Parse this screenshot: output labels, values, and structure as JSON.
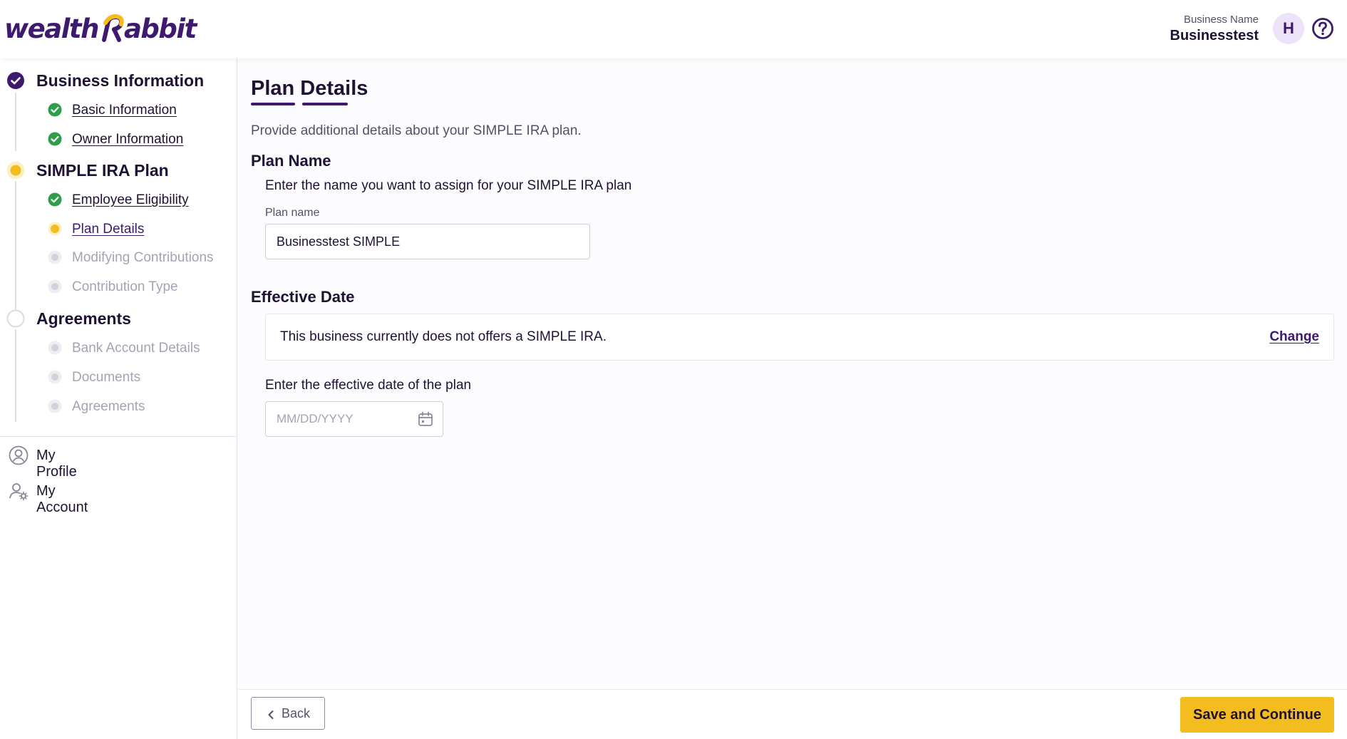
{
  "header": {
    "logo_text_left": "wealth",
    "logo_text_right": "abbit",
    "business_label": "Business Name",
    "business_name": "Businesstest",
    "avatar_initial": "H",
    "help_icon": "question-circle-icon"
  },
  "sidebar": {
    "sections": [
      {
        "label": "Business Information",
        "status": "complete"
      },
      {
        "label": "SIMPLE IRA Plan",
        "status": "in-progress"
      },
      {
        "label": "Agreements",
        "status": "not-started"
      }
    ],
    "business_information_items": [
      {
        "label": "Basic Information",
        "status": "complete"
      },
      {
        "label": "Owner Information",
        "status": "complete"
      }
    ],
    "simple_ira_items": [
      {
        "label": "Employee Eligibility",
        "status": "complete"
      },
      {
        "label": "Plan Details",
        "status": "current"
      },
      {
        "label": "Modifying Contributions",
        "status": "pending"
      },
      {
        "label": "Contribution Type",
        "status": "pending"
      }
    ],
    "agreements_items": [
      {
        "label": "Bank Account Details",
        "status": "pending"
      },
      {
        "label": "Documents",
        "status": "pending"
      },
      {
        "label": "Agreements",
        "status": "pending"
      }
    ],
    "nav": [
      {
        "label": "My Profile",
        "icon": "user-circle-icon"
      },
      {
        "label": "My Account",
        "icon": "user-gear-icon"
      }
    ]
  },
  "main": {
    "title": "Plan Details",
    "subtitle": "Provide additional details about your SIMPLE IRA plan.",
    "plan_name": {
      "heading": "Plan Name",
      "description": "Enter the name you want to assign for your SIMPLE IRA plan",
      "field_label": "Plan name",
      "value": "Businesstest SIMPLE"
    },
    "effective_date": {
      "heading": "Effective Date",
      "notice": "This business currently does not offers a SIMPLE IRA.",
      "change_label": "Change",
      "description": "Enter the effective date of the plan",
      "placeholder": "MM/DD/YYYY",
      "value": ""
    }
  },
  "footer": {
    "back_label": "Back",
    "save_label": "Save and Continue"
  },
  "colors": {
    "brand_purple": "#3d1a6e",
    "accent_yellow": "#f4bd1f",
    "success_green": "#2e9e4b",
    "pending_gray": "#d3d0da"
  }
}
